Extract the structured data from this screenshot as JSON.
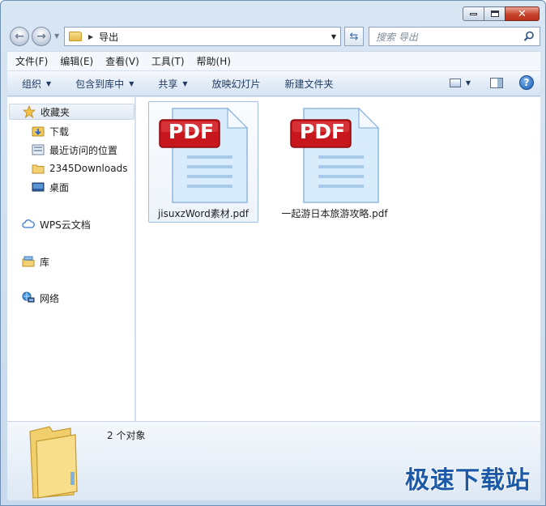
{
  "address": {
    "path": [
      "导出"
    ]
  },
  "search": {
    "placeholder": "搜索 导出"
  },
  "menubar": {
    "items": [
      "文件(F)",
      "编辑(E)",
      "查看(V)",
      "工具(T)",
      "帮助(H)"
    ]
  },
  "toolbar": {
    "organize": "组织",
    "include_in_library": "包含到库中",
    "share": "共享",
    "slideshow": "放映幻灯片",
    "new_folder": "新建文件夹"
  },
  "navpane": {
    "favorites": "收藏夹",
    "favorites_items": [
      "下载",
      "最近访问的位置",
      "2345Downloads",
      "桌面"
    ],
    "wps_cloud": "WPS云文档",
    "libraries": "库",
    "network": "网络"
  },
  "files": [
    {
      "name": "jisuxzWord素材.pdf",
      "badge": "PDF",
      "selected": true
    },
    {
      "name": "一起游日本旅游攻略.pdf",
      "badge": "PDF",
      "selected": false
    }
  ],
  "details": {
    "count": "2 个对象"
  },
  "watermark": "极速下载站",
  "colors": {
    "pdf_red": "#c8161d",
    "doc_blue": "#d9ecfb",
    "accent": "#1c5aa8"
  }
}
